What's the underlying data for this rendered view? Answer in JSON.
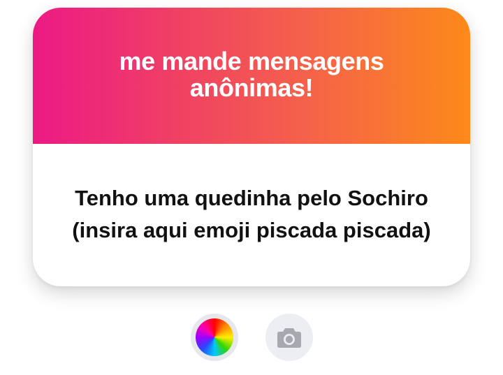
{
  "card": {
    "title": "me mande mensagens anônimas!",
    "message": "Tenho uma quedinha pelo Sochiro (insira aqui emoji piscada piscada)",
    "gradient_colors": [
      "#ec1a85",
      "#f5614b",
      "#fc8a19"
    ]
  },
  "actions": {
    "color_picker_icon": "color-wheel-icon",
    "camera_icon": "camera-icon",
    "camera_icon_color": "#a6a9b0"
  }
}
